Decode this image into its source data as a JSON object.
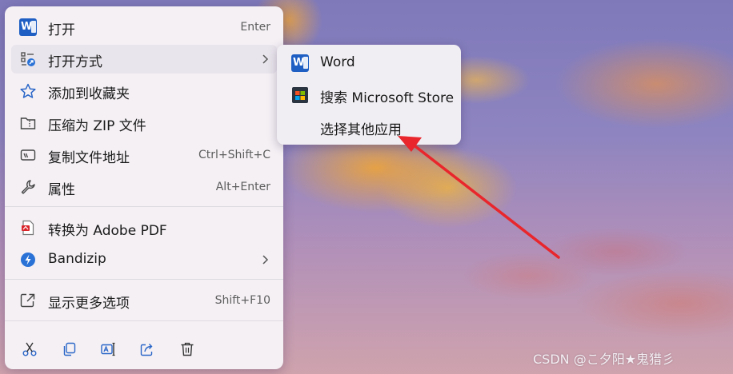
{
  "menu": {
    "items": [
      {
        "label": "打开",
        "shortcut": "Enter",
        "icon": "word-icon"
      },
      {
        "label": "打开方式",
        "shortcut": "",
        "icon": "open-with-icon",
        "has_submenu": true
      },
      {
        "label": "添加到收藏夹",
        "shortcut": "",
        "icon": "star-icon"
      },
      {
        "label": "压缩为 ZIP 文件",
        "shortcut": "",
        "icon": "zip-folder-icon"
      },
      {
        "label": "复制文件地址",
        "shortcut": "Ctrl+Shift+C",
        "icon": "copy-path-icon"
      },
      {
        "label": "属性",
        "shortcut": "Alt+Enter",
        "icon": "wrench-icon"
      },
      {
        "label": "转换为 Adobe PDF",
        "shortcut": "",
        "icon": "adobe-pdf-icon"
      },
      {
        "label": "Bandizip",
        "shortcut": "",
        "icon": "bandizip-icon",
        "has_submenu": true
      },
      {
        "label": "显示更多选项",
        "shortcut": "Shift+F10",
        "icon": "more-options-icon"
      }
    ],
    "toolbar": [
      "cut-icon",
      "copy-icon",
      "rename-icon",
      "share-icon",
      "delete-icon"
    ]
  },
  "submenu": {
    "items": [
      {
        "label": "Word",
        "icon": "word-icon"
      },
      {
        "label": "搜索 Microsoft Store",
        "icon": "microsoft-store-icon"
      },
      {
        "label": "选择其他应用",
        "icon": ""
      }
    ]
  },
  "watermark": "CSDN @こ夕阳★鬼猎彡",
  "colors": {
    "word_blue": "#1f5fc4",
    "annotation_arrow": "#e8262c",
    "bandizip_blue": "#2a72d6"
  }
}
